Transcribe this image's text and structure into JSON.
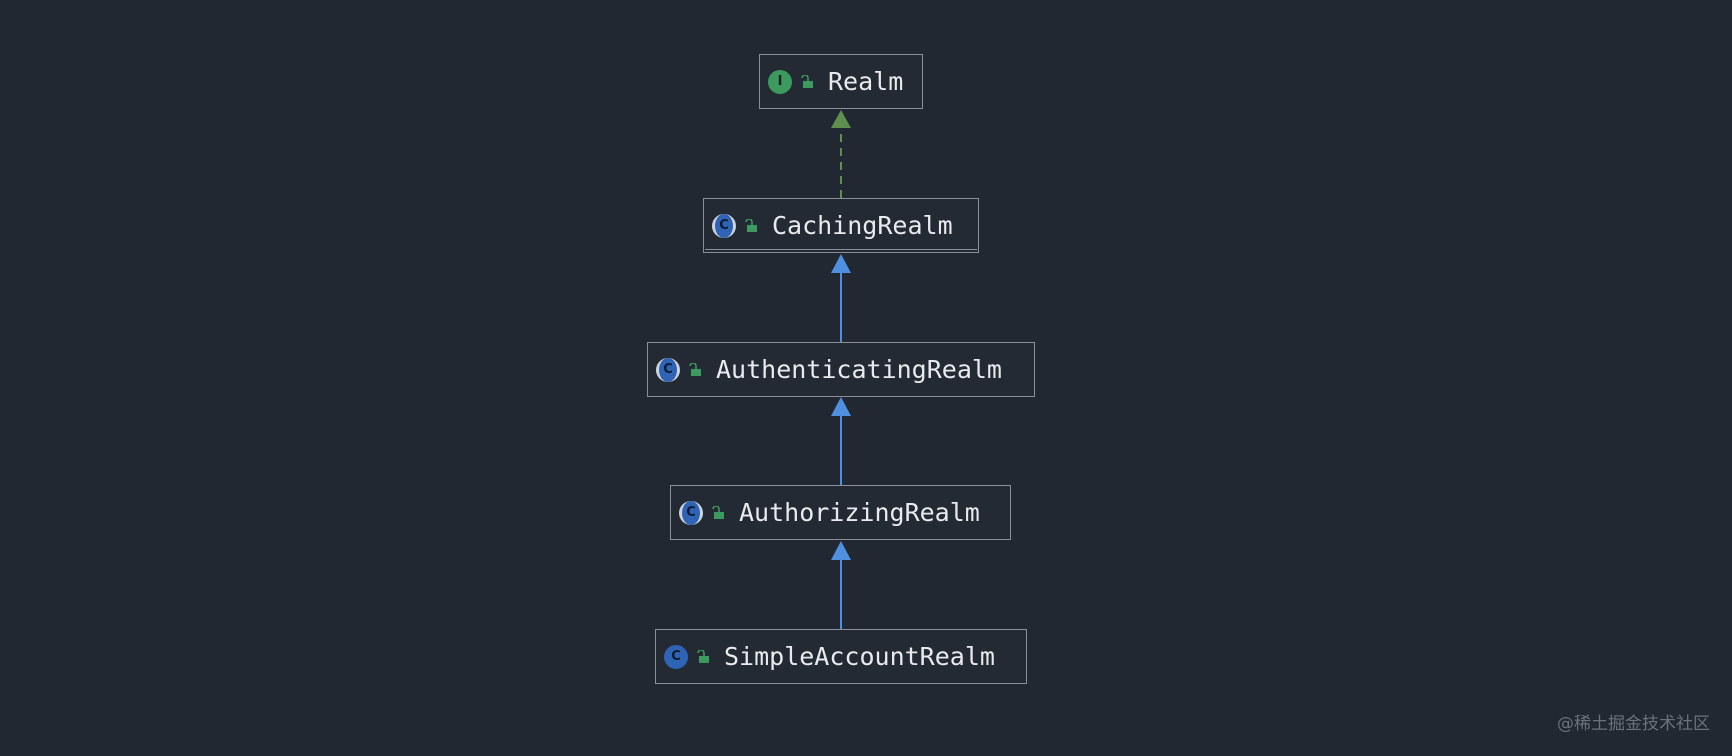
{
  "nodes": [
    {
      "id": "realm",
      "label": "Realm",
      "kind": "I",
      "kind_type": "interface"
    },
    {
      "id": "caching",
      "label": "CachingRealm",
      "kind": "C",
      "kind_type": "abstract"
    },
    {
      "id": "authenticating",
      "label": "AuthenticatingRealm",
      "kind": "C",
      "kind_type": "abstract"
    },
    {
      "id": "authorizing",
      "label": "AuthorizingRealm",
      "kind": "C",
      "kind_type": "abstract"
    },
    {
      "id": "simple",
      "label": "SimpleAccountRealm",
      "kind": "C",
      "kind_type": "class"
    }
  ],
  "edges": [
    {
      "from": "caching",
      "to": "realm",
      "type": "implements",
      "color": "#5f8f4e"
    },
    {
      "from": "authenticating",
      "to": "caching",
      "type": "extends",
      "color": "#4f8fe0"
    },
    {
      "from": "authorizing",
      "to": "authenticating",
      "type": "extends",
      "color": "#4f8fe0"
    },
    {
      "from": "simple",
      "to": "authorizing",
      "type": "extends",
      "color": "#4f8fe0"
    }
  ],
  "colors": {
    "background": "#222832",
    "interface": "#3c9a5f",
    "class": "#2f63b5",
    "lock": "#3c9a5f"
  },
  "watermark": "@稀土掘金技术社区"
}
